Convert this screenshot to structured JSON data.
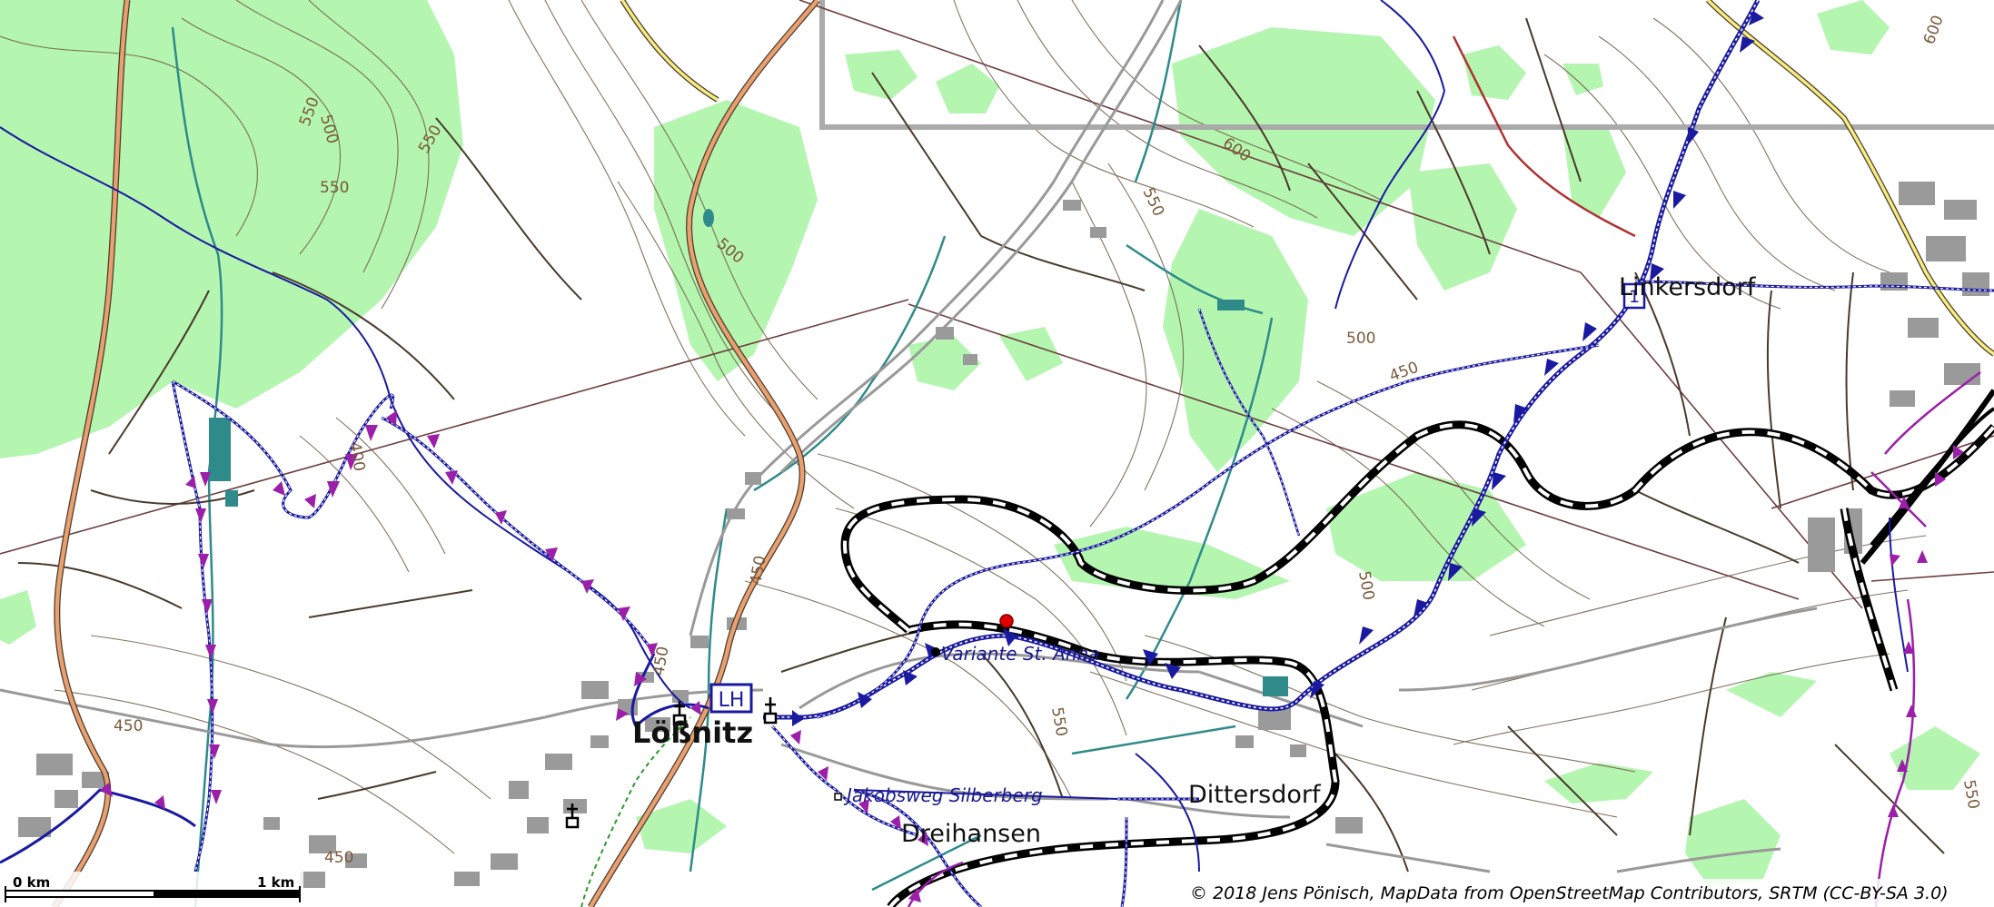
{
  "map": {
    "places": {
      "linkersdorf": "Linkersdorf",
      "lossnitz": "Lößnitz",
      "dittersdorf": "Dittersdorf",
      "dreihansen": "Dreihansen"
    },
    "routes": {
      "variante": "Variante St. Anna",
      "jakobsweg": "Jakobsweg Silberberg"
    },
    "badges": {
      "lh": "LH",
      "stage": "1"
    },
    "contours": [
      "550",
      "500",
      "550",
      "550",
      "500",
      "600",
      "550",
      "500",
      "450",
      "450",
      "450",
      "400",
      "450",
      "500",
      "550",
      "450",
      "550",
      "600"
    ],
    "scale": {
      "start": "0 km",
      "end": "1 km"
    },
    "attribution": "© 2018 Jens Pönisch, MapData from OpenStreetMap Contributors, SRTM (CC-BY-SA 3.0)",
    "colors": {
      "forest": "#b4f5b0",
      "contour": "#6e5a44",
      "route_main": "#1a1aa0",
      "route_alt": "#9b1fa8",
      "railway": "#000000",
      "stream": "#2f8a8a",
      "highway": "#e8a070",
      "secondary": "#f5ec80",
      "marker": "#e00000"
    }
  }
}
